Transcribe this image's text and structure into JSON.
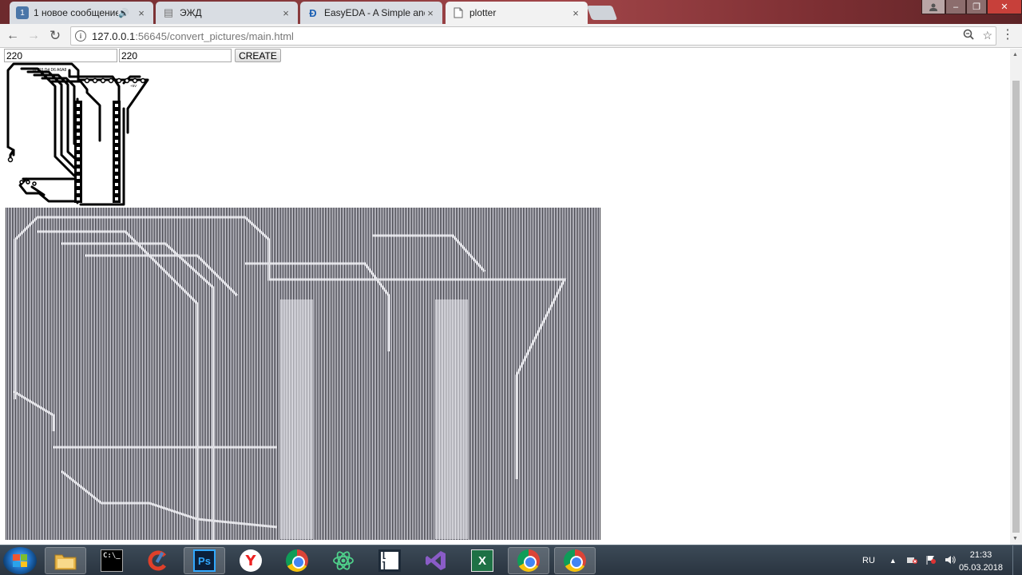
{
  "tabs": [
    {
      "title": "1 новое сообщение",
      "favicon_text": "1",
      "favicon_color": "#4a76a8",
      "audio": "🔊",
      "active": false
    },
    {
      "title": "ЭЖД",
      "favicon_text": "▤",
      "favicon_color": "#8a8a8a",
      "active": false
    },
    {
      "title": "EasyEDA - A Simple and",
      "favicon_text": "Ð",
      "favicon_color": "#1a5fb4",
      "active": false
    },
    {
      "title": "plotter",
      "favicon_text": "",
      "favicon_color": "#ffffff",
      "active": true
    }
  ],
  "tab_close_glyph": "×",
  "window_controls": {
    "minimize": "–",
    "maximize": "❐",
    "close": "✕"
  },
  "nav": {
    "back": "←",
    "forward": "→",
    "reload": "↻"
  },
  "address": {
    "host": "127.0.0.1",
    "rest": ":56645/convert_pictures/main.html",
    "info_glyph": "i"
  },
  "omnibox_icons": {
    "zoom": "🔍",
    "star": "☆"
  },
  "menu_glyph": "⋮",
  "form": {
    "width_value": "220",
    "height_value": "220",
    "create_label": "CREATE"
  },
  "preview": {
    "pin_labels": "a2 D3 D4 D6 A6A8",
    "power_label": "+5V"
  },
  "taskbar": {
    "apps": [
      {
        "name": "file-explorer",
        "label": ""
      },
      {
        "name": "command-prompt",
        "label": "C:\\_"
      },
      {
        "name": "ccleaner",
        "label": ""
      },
      {
        "name": "photoshop",
        "label": "Ps"
      },
      {
        "name": "yandex-browser",
        "label": "Y"
      },
      {
        "name": "chrome",
        "label": ""
      },
      {
        "name": "atom",
        "label": ""
      },
      {
        "name": "brackets",
        "label": "[ ]"
      },
      {
        "name": "visual-studio",
        "label": ""
      },
      {
        "name": "excel",
        "label": "X"
      },
      {
        "name": "chrome",
        "label": ""
      },
      {
        "name": "chrome",
        "label": ""
      }
    ],
    "language": "RU",
    "time": "21:33",
    "date": "05.03.2018"
  },
  "colors": {
    "plot_dark": "#2b2b33",
    "plot_light": "#ebebf2",
    "pcb_trace": "#000000"
  }
}
